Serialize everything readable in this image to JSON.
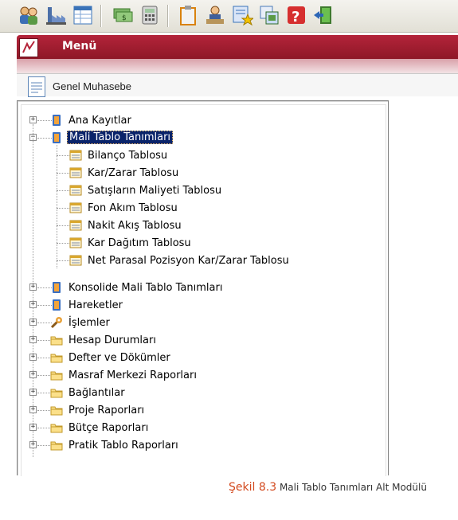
{
  "toolbar": {
    "buttons": [
      {
        "name": "users-icon"
      },
      {
        "name": "factory-icon"
      },
      {
        "name": "grid-window-icon"
      },
      {
        "name": "money-icon"
      },
      {
        "name": "calculator-icon"
      },
      {
        "name": "clipboard-icon"
      },
      {
        "name": "user-desk-icon"
      },
      {
        "name": "report-star-icon"
      },
      {
        "name": "copy-windows-icon"
      },
      {
        "name": "help-icon"
      },
      {
        "name": "exit-door-icon"
      }
    ]
  },
  "menu": {
    "title": "Menü"
  },
  "module": {
    "label": "Genel Muhasebe"
  },
  "tree": {
    "ana_kayitlar": "Ana Kayıtlar",
    "mali_tablo": "Mali Tablo Tanımları",
    "children": [
      "Bilanço Tablosu",
      "Kar/Zarar Tablosu",
      "Satışların Maliyeti Tablosu",
      "Fon Akım Tablosu",
      "Nakit Akış Tablosu",
      "Kar Dağıtım Tablosu",
      "Net Parasal Pozisyon Kar/Zarar Tablosu"
    ],
    "konsolide": "Konsolide Mali Tablo Tanımları",
    "hareketler": "Hareketler",
    "islemler": "İşlemler",
    "folders": [
      "Hesap Durumları",
      "Defter ve Dökümler",
      "Masraf Merkezi Raporları",
      "Bağlantılar",
      "Proje Raporları",
      "Bütçe Raporları",
      "Pratik Tablo Raporları"
    ]
  },
  "caption": {
    "prefix": "Şekil 8.3",
    "text": "Mali Tablo Tanımları Alt Modülü"
  },
  "colors": {
    "menu_bar": "#9d1c2f",
    "selection": "#0a246a",
    "caption_accent": "#d34a1f"
  }
}
